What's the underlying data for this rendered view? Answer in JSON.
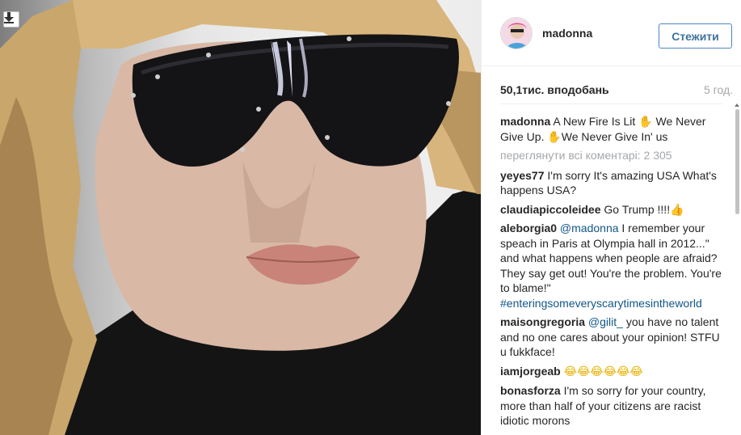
{
  "header": {
    "username": "madonna",
    "follow_label": "Стежити"
  },
  "stats": {
    "likes": "50,1тис. вподобань",
    "time": "5 год."
  },
  "caption": {
    "user": "madonna",
    "text": "A New Fire Is Lit ✋ We Never Give Up. ✋We Never Give In' us"
  },
  "view_all": "переглянути всі коментарі: 2 305",
  "comments": [
    {
      "user": "yeyes77",
      "text": "I'm sorry It's amazing USA What's happens USA?"
    },
    {
      "user": "claudiapiccoleidee",
      "text": "Go Trump !!!!👍"
    },
    {
      "user": "aleborgia0",
      "mention": "@madonna",
      "text": "I remember your speach in Paris at Olympia hall in 2012...\" and what happens when people are afraid? They say get out! You're the problem. You're to blame!\"",
      "hashtag": "#enteringsomeveryscarytimesintheworld"
    },
    {
      "user": "maisongregoria",
      "mention": "@gilit_",
      "text": "you have no talent and no one cares about your opinion! STFU u fukkface!"
    },
    {
      "user": "iamjorgeab",
      "text": "😂😂😂😂😂😂"
    },
    {
      "user": "bonasforza",
      "text": "I'm so sorry for your country, more than half of your citizens are racist idiotic morons"
    }
  ],
  "icons": {
    "download": "download-icon",
    "avatar": "profile-avatar"
  },
  "colors": {
    "link": "#125688",
    "follow_border": "#4a86c8",
    "muted": "#a5a7aa"
  }
}
